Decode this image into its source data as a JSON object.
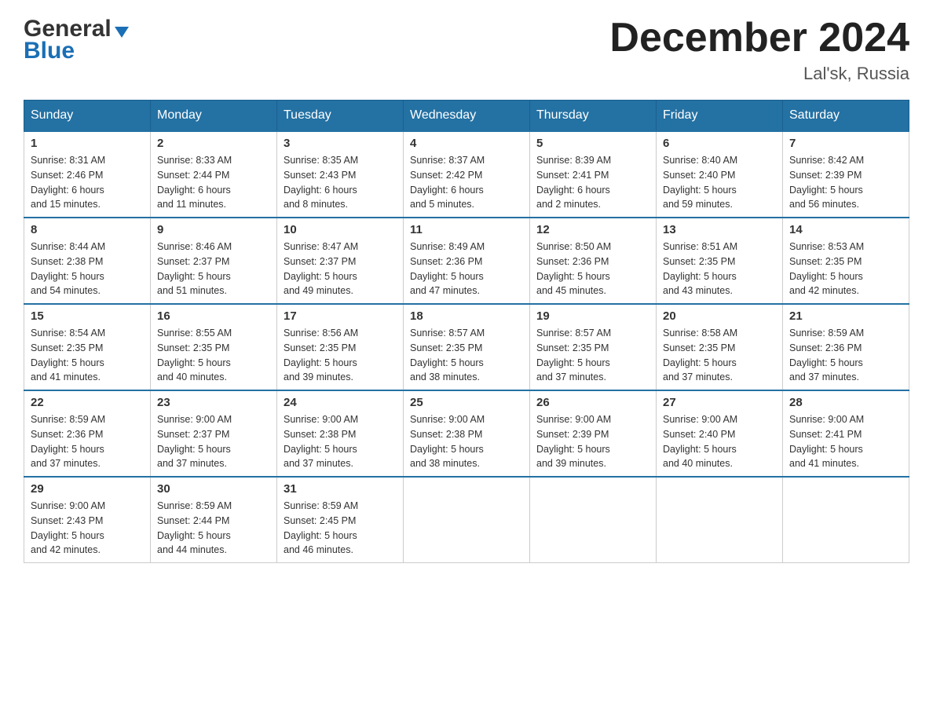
{
  "header": {
    "logo": {
      "general": "General",
      "blue": "Blue"
    },
    "title": "December 2024",
    "location": "Lal'sk, Russia"
  },
  "weekdays": [
    "Sunday",
    "Monday",
    "Tuesday",
    "Wednesday",
    "Thursday",
    "Friday",
    "Saturday"
  ],
  "weeks": [
    [
      {
        "day": "1",
        "sunrise": "Sunrise: 8:31 AM",
        "sunset": "Sunset: 2:46 PM",
        "daylight": "Daylight: 6 hours",
        "minutes": "and 15 minutes."
      },
      {
        "day": "2",
        "sunrise": "Sunrise: 8:33 AM",
        "sunset": "Sunset: 2:44 PM",
        "daylight": "Daylight: 6 hours",
        "minutes": "and 11 minutes."
      },
      {
        "day": "3",
        "sunrise": "Sunrise: 8:35 AM",
        "sunset": "Sunset: 2:43 PM",
        "daylight": "Daylight: 6 hours",
        "minutes": "and 8 minutes."
      },
      {
        "day": "4",
        "sunrise": "Sunrise: 8:37 AM",
        "sunset": "Sunset: 2:42 PM",
        "daylight": "Daylight: 6 hours",
        "minutes": "and 5 minutes."
      },
      {
        "day": "5",
        "sunrise": "Sunrise: 8:39 AM",
        "sunset": "Sunset: 2:41 PM",
        "daylight": "Daylight: 6 hours",
        "minutes": "and 2 minutes."
      },
      {
        "day": "6",
        "sunrise": "Sunrise: 8:40 AM",
        "sunset": "Sunset: 2:40 PM",
        "daylight": "Daylight: 5 hours",
        "minutes": "and 59 minutes."
      },
      {
        "day": "7",
        "sunrise": "Sunrise: 8:42 AM",
        "sunset": "Sunset: 2:39 PM",
        "daylight": "Daylight: 5 hours",
        "minutes": "and 56 minutes."
      }
    ],
    [
      {
        "day": "8",
        "sunrise": "Sunrise: 8:44 AM",
        "sunset": "Sunset: 2:38 PM",
        "daylight": "Daylight: 5 hours",
        "minutes": "and 54 minutes."
      },
      {
        "day": "9",
        "sunrise": "Sunrise: 8:46 AM",
        "sunset": "Sunset: 2:37 PM",
        "daylight": "Daylight: 5 hours",
        "minutes": "and 51 minutes."
      },
      {
        "day": "10",
        "sunrise": "Sunrise: 8:47 AM",
        "sunset": "Sunset: 2:37 PM",
        "daylight": "Daylight: 5 hours",
        "minutes": "and 49 minutes."
      },
      {
        "day": "11",
        "sunrise": "Sunrise: 8:49 AM",
        "sunset": "Sunset: 2:36 PM",
        "daylight": "Daylight: 5 hours",
        "minutes": "and 47 minutes."
      },
      {
        "day": "12",
        "sunrise": "Sunrise: 8:50 AM",
        "sunset": "Sunset: 2:36 PM",
        "daylight": "Daylight: 5 hours",
        "minutes": "and 45 minutes."
      },
      {
        "day": "13",
        "sunrise": "Sunrise: 8:51 AM",
        "sunset": "Sunset: 2:35 PM",
        "daylight": "Daylight: 5 hours",
        "minutes": "and 43 minutes."
      },
      {
        "day": "14",
        "sunrise": "Sunrise: 8:53 AM",
        "sunset": "Sunset: 2:35 PM",
        "daylight": "Daylight: 5 hours",
        "minutes": "and 42 minutes."
      }
    ],
    [
      {
        "day": "15",
        "sunrise": "Sunrise: 8:54 AM",
        "sunset": "Sunset: 2:35 PM",
        "daylight": "Daylight: 5 hours",
        "minutes": "and 41 minutes."
      },
      {
        "day": "16",
        "sunrise": "Sunrise: 8:55 AM",
        "sunset": "Sunset: 2:35 PM",
        "daylight": "Daylight: 5 hours",
        "minutes": "and 40 minutes."
      },
      {
        "day": "17",
        "sunrise": "Sunrise: 8:56 AM",
        "sunset": "Sunset: 2:35 PM",
        "daylight": "Daylight: 5 hours",
        "minutes": "and 39 minutes."
      },
      {
        "day": "18",
        "sunrise": "Sunrise: 8:57 AM",
        "sunset": "Sunset: 2:35 PM",
        "daylight": "Daylight: 5 hours",
        "minutes": "and 38 minutes."
      },
      {
        "day": "19",
        "sunrise": "Sunrise: 8:57 AM",
        "sunset": "Sunset: 2:35 PM",
        "daylight": "Daylight: 5 hours",
        "minutes": "and 37 minutes."
      },
      {
        "day": "20",
        "sunrise": "Sunrise: 8:58 AM",
        "sunset": "Sunset: 2:35 PM",
        "daylight": "Daylight: 5 hours",
        "minutes": "and 37 minutes."
      },
      {
        "day": "21",
        "sunrise": "Sunrise: 8:59 AM",
        "sunset": "Sunset: 2:36 PM",
        "daylight": "Daylight: 5 hours",
        "minutes": "and 37 minutes."
      }
    ],
    [
      {
        "day": "22",
        "sunrise": "Sunrise: 8:59 AM",
        "sunset": "Sunset: 2:36 PM",
        "daylight": "Daylight: 5 hours",
        "minutes": "and 37 minutes."
      },
      {
        "day": "23",
        "sunrise": "Sunrise: 9:00 AM",
        "sunset": "Sunset: 2:37 PM",
        "daylight": "Daylight: 5 hours",
        "minutes": "and 37 minutes."
      },
      {
        "day": "24",
        "sunrise": "Sunrise: 9:00 AM",
        "sunset": "Sunset: 2:38 PM",
        "daylight": "Daylight: 5 hours",
        "minutes": "and 37 minutes."
      },
      {
        "day": "25",
        "sunrise": "Sunrise: 9:00 AM",
        "sunset": "Sunset: 2:38 PM",
        "daylight": "Daylight: 5 hours",
        "minutes": "and 38 minutes."
      },
      {
        "day": "26",
        "sunrise": "Sunrise: 9:00 AM",
        "sunset": "Sunset: 2:39 PM",
        "daylight": "Daylight: 5 hours",
        "minutes": "and 39 minutes."
      },
      {
        "day": "27",
        "sunrise": "Sunrise: 9:00 AM",
        "sunset": "Sunset: 2:40 PM",
        "daylight": "Daylight: 5 hours",
        "minutes": "and 40 minutes."
      },
      {
        "day": "28",
        "sunrise": "Sunrise: 9:00 AM",
        "sunset": "Sunset: 2:41 PM",
        "daylight": "Daylight: 5 hours",
        "minutes": "and 41 minutes."
      }
    ],
    [
      {
        "day": "29",
        "sunrise": "Sunrise: 9:00 AM",
        "sunset": "Sunset: 2:43 PM",
        "daylight": "Daylight: 5 hours",
        "minutes": "and 42 minutes."
      },
      {
        "day": "30",
        "sunrise": "Sunrise: 8:59 AM",
        "sunset": "Sunset: 2:44 PM",
        "daylight": "Daylight: 5 hours",
        "minutes": "and 44 minutes."
      },
      {
        "day": "31",
        "sunrise": "Sunrise: 8:59 AM",
        "sunset": "Sunset: 2:45 PM",
        "daylight": "Daylight: 5 hours",
        "minutes": "and 46 minutes."
      },
      null,
      null,
      null,
      null
    ]
  ]
}
